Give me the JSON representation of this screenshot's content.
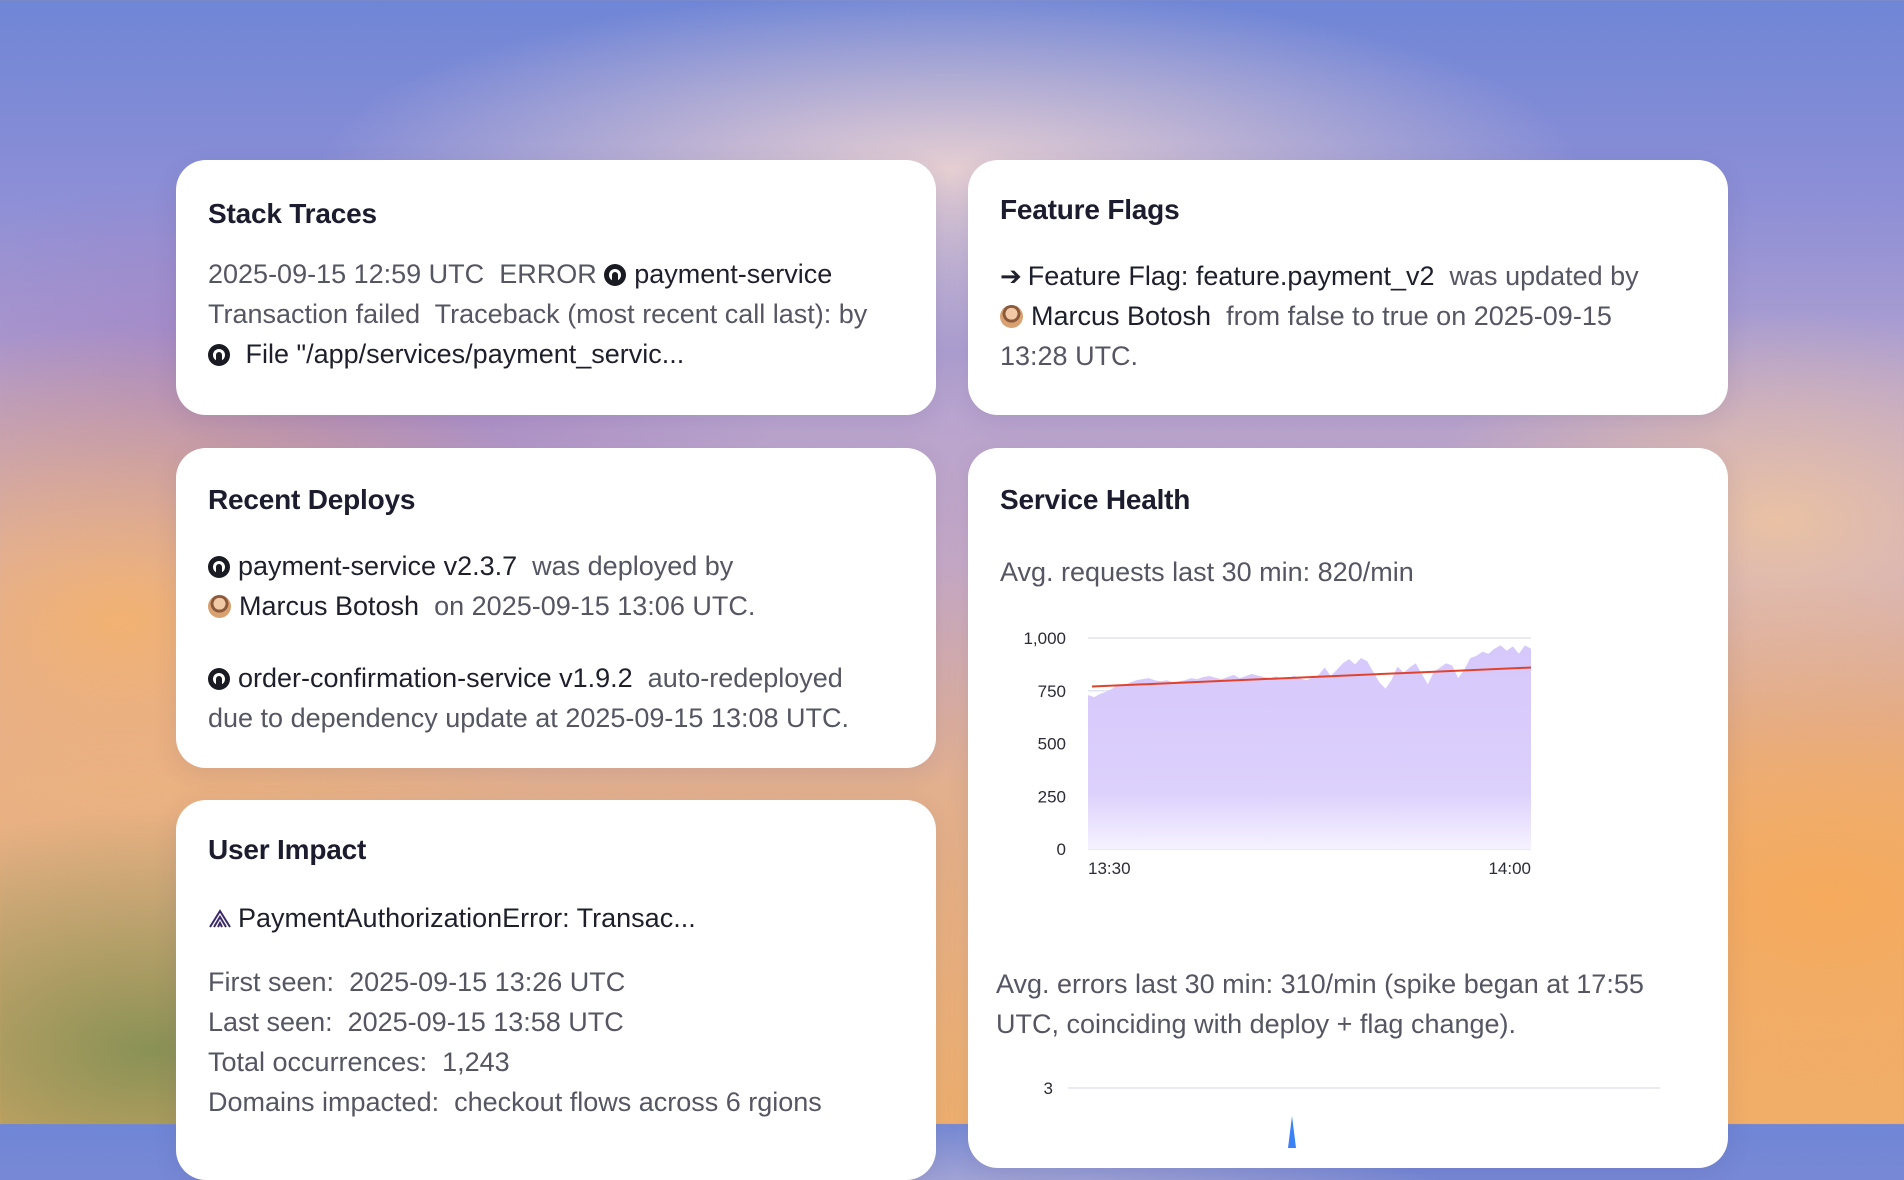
{
  "stack_traces": {
    "title": "Stack Traces",
    "timestamp": "2025-09-15 12:59 UTC",
    "level": "ERROR",
    "service": "payment-service",
    "message": "Transaction failed",
    "traceback": "Traceback (most recent call last): by",
    "file": "File \"/app/services/payment_servic..."
  },
  "feature_flags": {
    "title": "Feature Flags",
    "flag": "Feature Flag: feature.payment_v2",
    "updated_by_text": "was updated by",
    "user": "Marcus Botosh",
    "change_text": "from false to true on",
    "date": "2025-09-15",
    "time": "13:28 UTC."
  },
  "recent_deploys": {
    "title": "Recent Deploys",
    "deploy1": {
      "service": "payment-service v2.3.7",
      "action": "was deployed by",
      "user": "Marcus Botosh",
      "on": "on",
      "date": "2025-09-15 13:06 UTC."
    },
    "deploy2": {
      "service": "order-confirmation-service v1.9.2",
      "action": "auto-redeployed",
      "reason": "due to dependency update at",
      "date": "2025-09-15 13:08 UTC."
    }
  },
  "user_impact": {
    "title": "User Impact",
    "issue": "PaymentAuthorizationError: Transac...",
    "first_seen_label": "First seen:",
    "first_seen": "2025-09-15 13:26 UTC",
    "last_seen_label": "Last seen:",
    "last_seen": "2025-09-15 13:58 UTC",
    "occurrences_label": "Total occurrences:",
    "occurrences": "1,243",
    "domains_label": "Domains impacted:",
    "domains": "checkout flows across 6 rgions"
  },
  "service_health": {
    "title": "Service Health",
    "requests_text": "Avg. requests last 30 min: 820/min",
    "errors_text_1": "Avg. errors last 30 min: 310/min (spike began at 17:55",
    "errors_text_2": "UTC, coinciding with deploy + flag change).",
    "errors_chart_ytick": "3"
  },
  "chart_data": {
    "type": "area",
    "title": "",
    "xlabel": "",
    "ylabel": "",
    "x_tick_labels": [
      "13:30",
      "14:00"
    ],
    "y_tick_labels": [
      "1,000",
      "750",
      "500",
      "250",
      "0"
    ],
    "ylim": [
      0,
      1000
    ],
    "grid": true,
    "series": [
      {
        "values": [
          730,
          720,
          735,
          745,
          760,
          780,
          775,
          790,
          800,
          805,
          810,
          800,
          795,
          800,
          790,
          795,
          800,
          810,
          805,
          815,
          820,
          812,
          805,
          815,
          825,
          810,
          820,
          830,
          822,
          815,
          810,
          818,
          805,
          812,
          820,
          808,
          800,
          812,
          825,
          860,
          820,
          850,
          880,
          900,
          875,
          905,
          890,
          840,
          790,
          760,
          800,
          865,
          835,
          860,
          880,
          830,
          780,
          840,
          860,
          880,
          870,
          810,
          850,
          905,
          915,
          935,
          925,
          950,
          965,
          940,
          960,
          925,
          965,
          950
        ]
      },
      {
        "type": "trend",
        "values": [
          770,
          860
        ]
      }
    ],
    "colors": {
      "area": "#d8ccfc",
      "trend": "#e0432e",
      "grid": "#e4e4ee"
    }
  }
}
